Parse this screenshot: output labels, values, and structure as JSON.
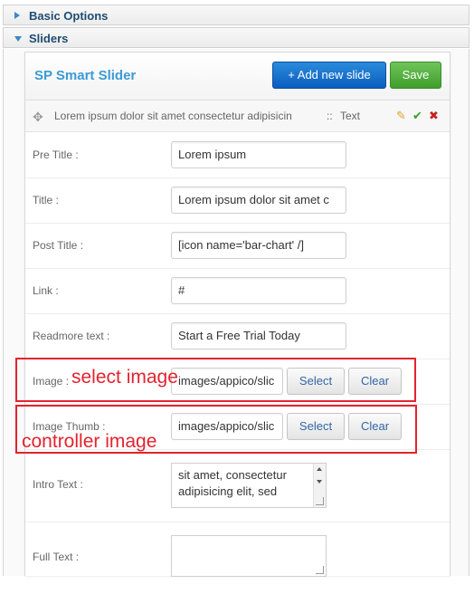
{
  "accordion": {
    "basic_options": "Basic Options",
    "sliders": "Sliders"
  },
  "slider": {
    "title": "SP Smart Slider",
    "add_button": "+ Add new slide",
    "save_button": "Save",
    "slide": {
      "title": "Lorem ipsum dolor sit amet consectetur adipisicin",
      "separator": "::",
      "type": "Text"
    }
  },
  "form": {
    "pre_title": {
      "label": "Pre Title :",
      "value": "Lorem ipsum"
    },
    "title": {
      "label": "Title :",
      "value": "Lorem ipsum dolor sit  amet c"
    },
    "post_title": {
      "label": "Post Title :",
      "value": "[icon name='bar-chart' /]"
    },
    "link": {
      "label": "Link :",
      "value": "#"
    },
    "readmore": {
      "label": "Readmore text :",
      "value": "Start a Free Trial Today"
    },
    "image": {
      "label": "Image :",
      "value": "images/appico/slic",
      "select": "Select",
      "clear": "Clear"
    },
    "image_thumb": {
      "label": "Image Thumb :",
      "value": "images/appico/slic",
      "select": "Select",
      "clear": "Clear"
    },
    "intro_text": {
      "label": "Intro Text :",
      "line1": "sit amet, consectetur",
      "line2": "adipisicing elit, sed"
    },
    "full_text": {
      "label": "Full Text :"
    }
  },
  "annotations": {
    "image_note": "select image",
    "thumb_note": "controller image",
    "color": "#e3232f"
  },
  "icons": [
    "caret-right-icon",
    "caret-down-icon",
    "move-icon",
    "edit-icon",
    "check-icon",
    "delete-icon"
  ]
}
